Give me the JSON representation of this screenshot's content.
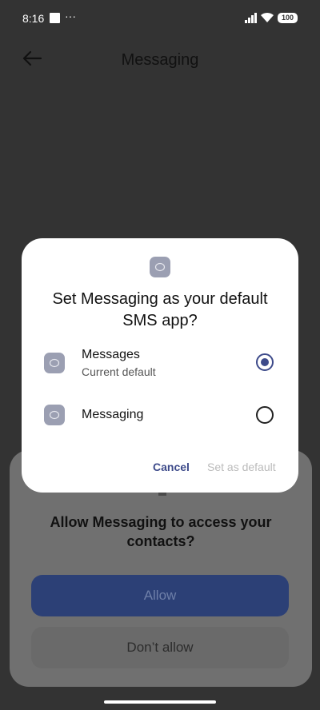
{
  "status_bar": {
    "time": "8:16",
    "dots": "···",
    "battery": "100"
  },
  "app_bar": {
    "title": "Messaging"
  },
  "dialog": {
    "title": "Set Messaging as your default SMS app?",
    "options": [
      {
        "label": "Messages",
        "sublabel": "Current default",
        "selected": true
      },
      {
        "label": "Messaging",
        "selected": false
      }
    ],
    "cancel_label": "Cancel",
    "set_default_label": "Set as default"
  },
  "permission_sheet": {
    "title": "Allow Messaging to access your contacts?",
    "allow_label": "Allow",
    "dont_allow_label": "Don’t allow"
  },
  "colors": {
    "accent": "#3d4a8a",
    "scrim": "#333333",
    "dialog_bg": "#ffffff"
  }
}
